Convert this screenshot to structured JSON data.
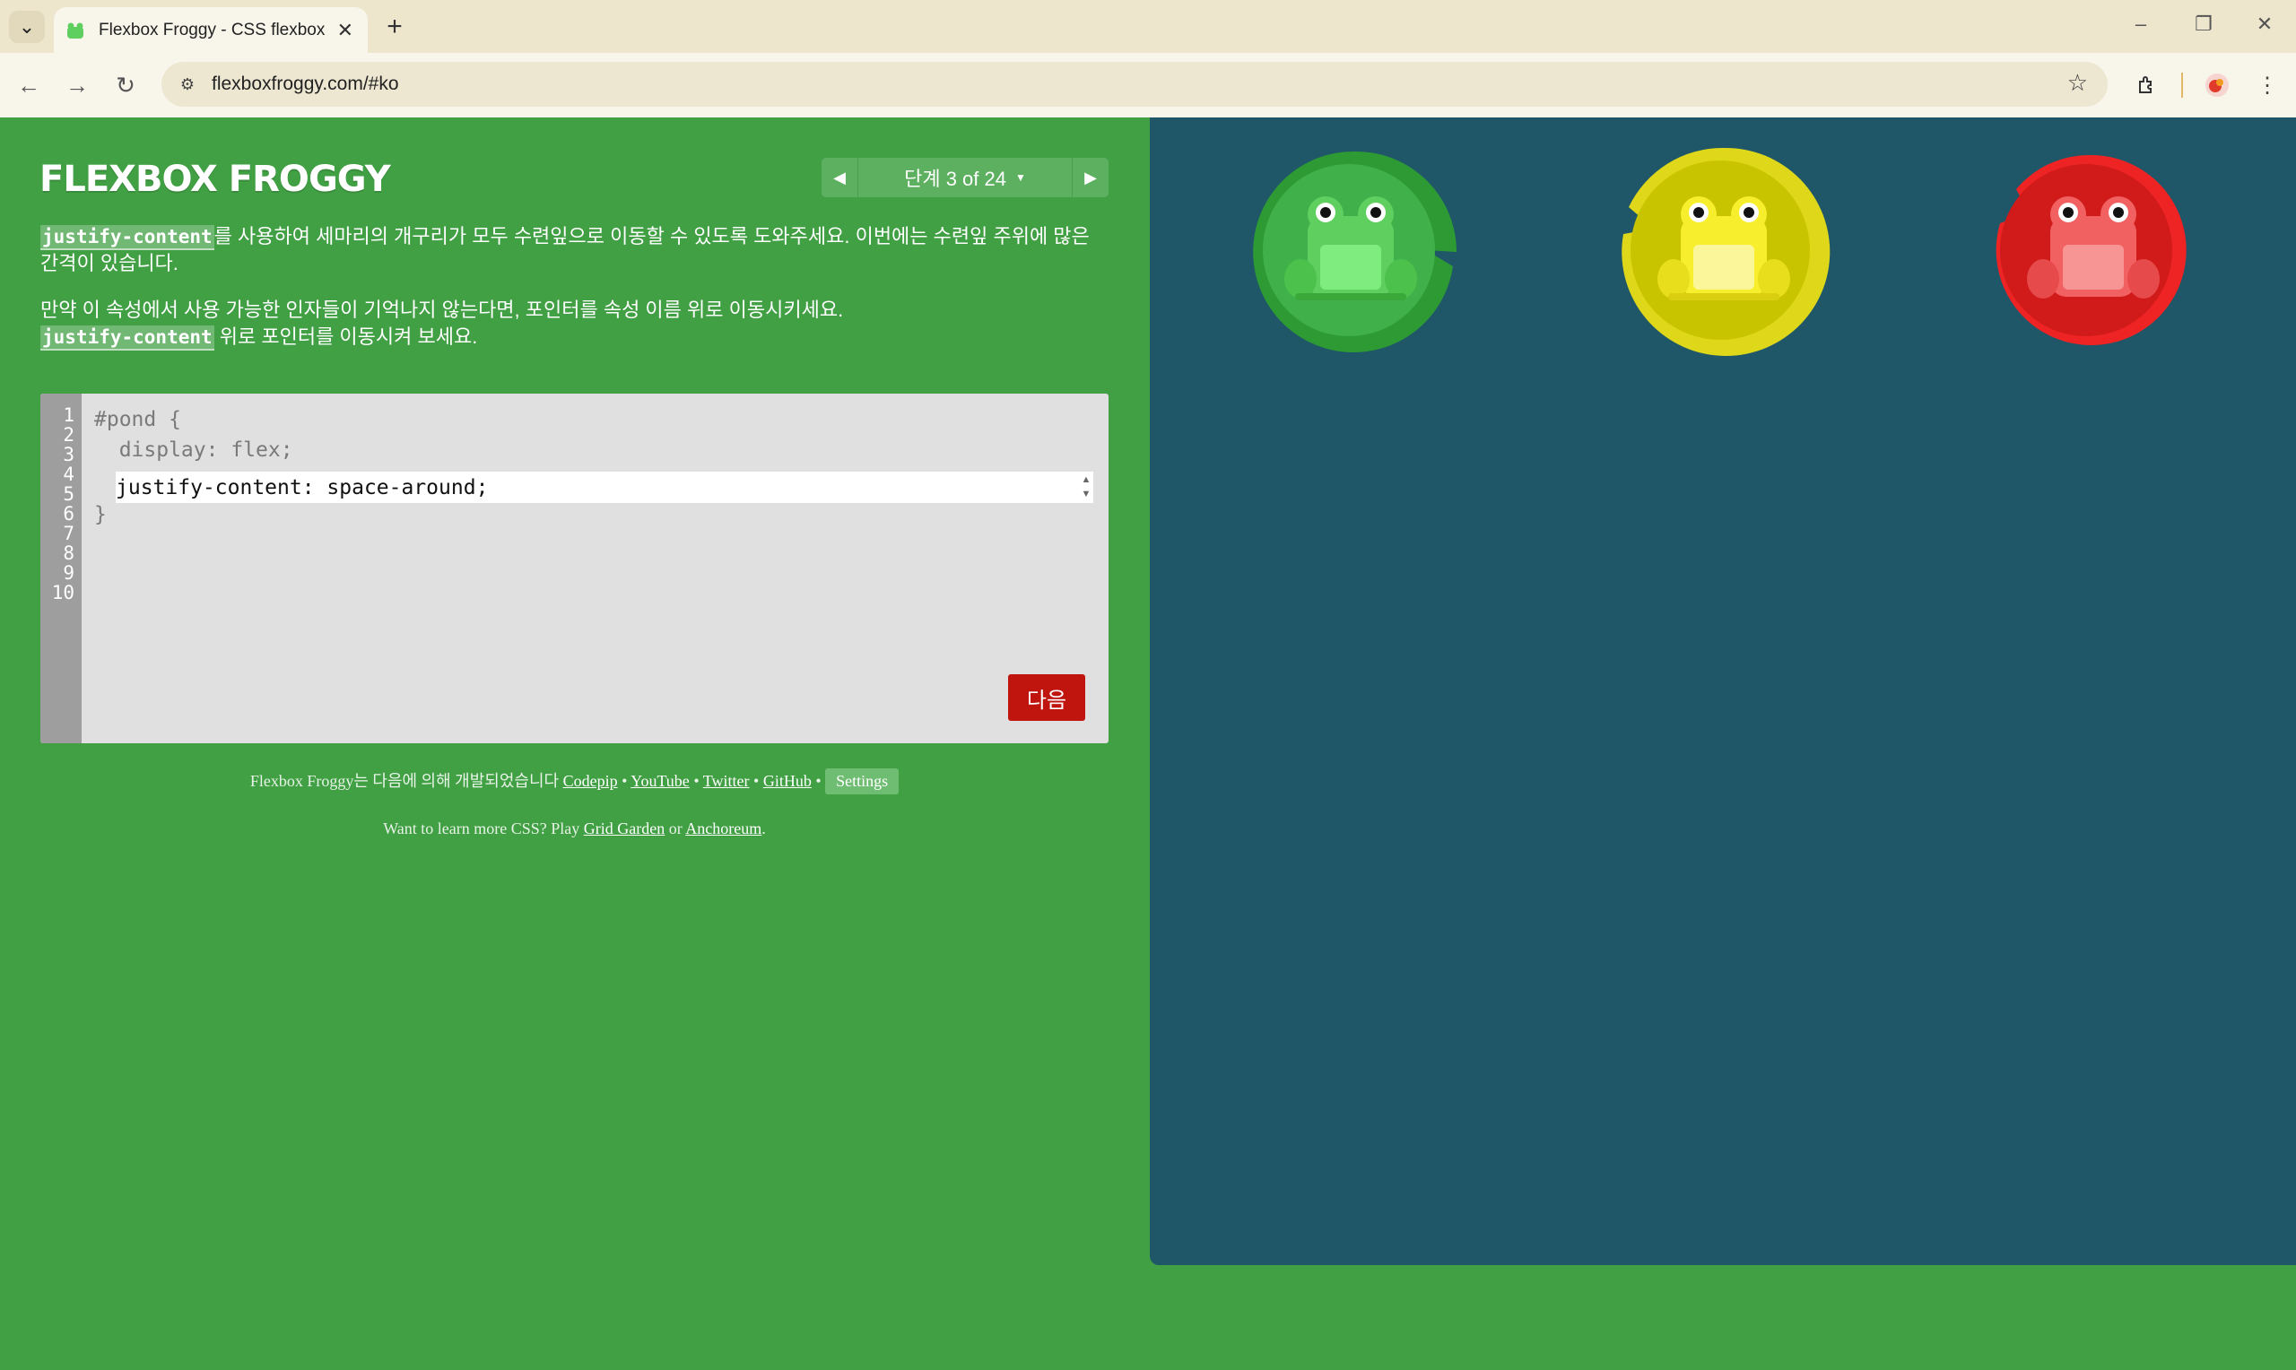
{
  "browser": {
    "tab_title": "Flexbox Froggy - CSS flexbox",
    "url": "flexboxfroggy.com/#ko",
    "icons": [
      "tab-list-icon",
      "favicon-frog-icon",
      "close-icon",
      "plus-icon",
      "minimize-icon",
      "restore-icon",
      "window-close-icon",
      "back-icon",
      "forward-icon",
      "reload-icon",
      "site-info-icon",
      "star-icon",
      "extensions-icon",
      "profile-avatar-icon",
      "menu-dots-icon"
    ]
  },
  "header": {
    "logo": "FLEXBOX FROGGY",
    "level_label": "단계 3 of 24"
  },
  "instructions": {
    "p1_keyword": "justify-content",
    "p1_text": "를 사용하여 세마리의 개구리가 모두 수련잎으로 이동할 수 있도록 도와주세요. 이번에는 수련잎 주위에 많은 간격이 있습니다.",
    "p2_text": "만약 이 속성에서 사용 가능한 인자들이 기억나지 않는다면, 포인터를 속성 이름 위로 이동시키세요.",
    "p2_keyword": "justify-content",
    "p2_tail": " 위로 포인터를 이동시켜 보세요."
  },
  "editor": {
    "line_numbers": [
      "1",
      "2",
      "3",
      "4",
      "5",
      "6",
      "7",
      "8",
      "9",
      "10"
    ],
    "line1": "#pond {",
    "line2": "  display: flex;",
    "input_value": "justify-content: space-around;",
    "line4": "}",
    "next_label": "다음"
  },
  "footer": {
    "credit_prefix": "Flexbox Froggy는 다음에 의해 개발되었습니다 ",
    "codepip": "Codepip",
    "youtube": "YouTube",
    "twitter": "Twitter",
    "github": "GitHub",
    "separator": " • ",
    "settings": "Settings",
    "learn_prefix": "Want to learn more CSS? Play ",
    "grid_garden": "Grid Garden",
    "or": " or ",
    "anchoreum": "Anchoreum",
    "period": "."
  },
  "pond": {
    "background": "#1f5768",
    "frogs": [
      {
        "color": "green",
        "frog_hex": "#5fcf5f",
        "lily_hex": "#2e9a33"
      },
      {
        "color": "yellow",
        "frog_hex": "#f7ee2e",
        "lily_hex": "#c9c400"
      },
      {
        "color": "red",
        "frog_hex": "#f26161",
        "lily_hex": "#d11a1a"
      }
    ]
  }
}
